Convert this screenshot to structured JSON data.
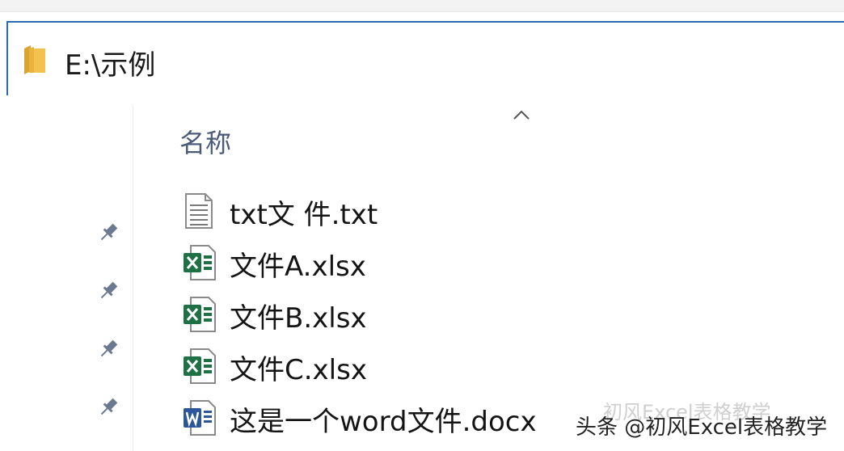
{
  "address_bar": {
    "path": "E:\\示例",
    "icon": "folder-icon"
  },
  "file_list": {
    "column_header": "名称",
    "sort_indicator": "chevron-up-icon",
    "files": [
      {
        "name": "txt文 件.txt",
        "icon": "text-file-icon"
      },
      {
        "name": "文件A.xlsx",
        "icon": "excel-file-icon"
      },
      {
        "name": "文件B.xlsx",
        "icon": "excel-file-icon"
      },
      {
        "name": "文件C.xlsx",
        "icon": "excel-file-icon"
      },
      {
        "name": "这是一个word文件.docx",
        "icon": "word-file-icon"
      }
    ]
  },
  "quick_access": {
    "pins": [
      "pin-icon",
      "pin-icon",
      "pin-icon",
      "pin-icon"
    ]
  },
  "watermark": {
    "text": "头条 @初风Excel表格教学",
    "ghost_text": "初风Excel表格教学"
  },
  "colors": {
    "accent_border": "#2b6cb0",
    "excel_green": "#1e7145",
    "word_blue": "#2b579a",
    "folder_yellow": "#f2c14e"
  }
}
